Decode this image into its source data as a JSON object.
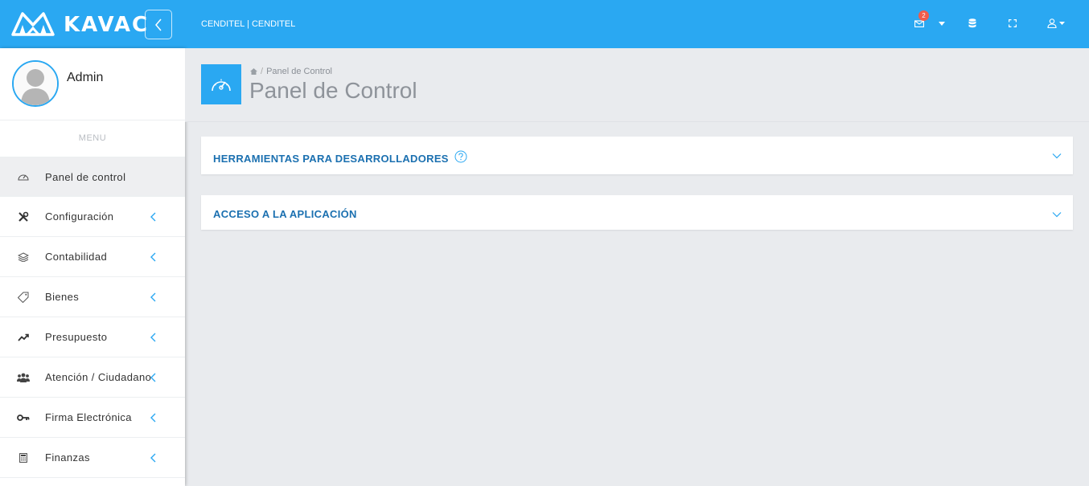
{
  "brand": {
    "name": "KAVAC"
  },
  "header": {
    "organization": "CENDITEL | CENDITEL",
    "notification_count": "2"
  },
  "user": {
    "name": "Admin"
  },
  "sidebar": {
    "menu_header": "MENU",
    "items": [
      {
        "label": "Panel de control",
        "icon": "dashboard-icon",
        "active": true
      },
      {
        "label": "Configuración",
        "icon": "tools-icon"
      },
      {
        "label": "Contabilidad",
        "icon": "layers-icon"
      },
      {
        "label": "Bienes",
        "icon": "tag-icon"
      },
      {
        "label": "Presupuesto",
        "icon": "trend-icon"
      },
      {
        "label": "Atención / Ciudadano",
        "icon": "users-icon"
      },
      {
        "label": "Firma Electrónica",
        "icon": "key-icon"
      },
      {
        "label": "Finanzas",
        "icon": "calculator-icon"
      }
    ]
  },
  "page": {
    "breadcrumb": "Panel de Control",
    "title": "Panel de Control"
  },
  "panels": [
    {
      "title": "HERRAMIENTAS PARA DESARROLLADORES"
    },
    {
      "title": "ACCESO A LA APLICACIÓN"
    }
  ],
  "colors": {
    "primary": "#2aa8f2",
    "panel_title": "#1b70b0",
    "badge": "#f05c4b",
    "background": "#e9ebee"
  }
}
